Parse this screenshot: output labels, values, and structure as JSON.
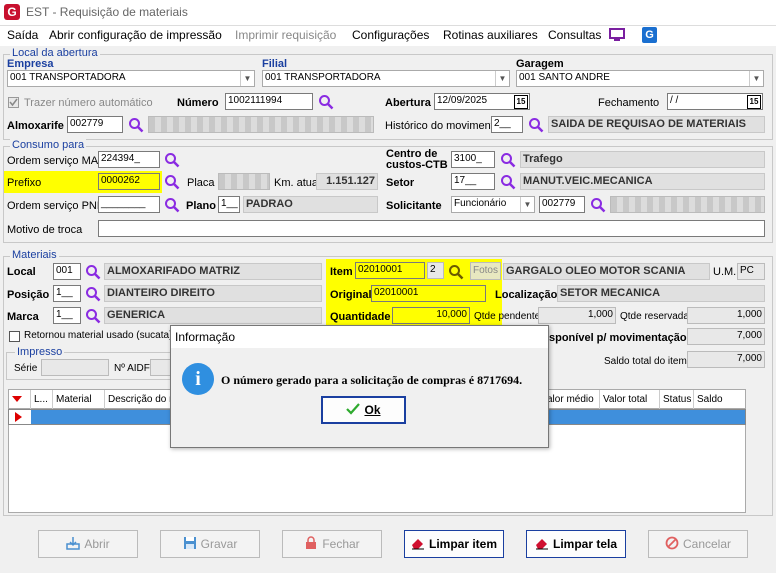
{
  "window": {
    "title": "EST - Requisição de materiais",
    "logo": "G"
  },
  "menu": [
    "Saída",
    "Abrir configuração de impressão",
    "Imprimir requisição",
    "Configurações",
    "Rotinas auxiliares",
    "Consultas"
  ],
  "local_abertura": {
    "title": "Local da abertura",
    "empresa_label": "Empresa",
    "empresa_value": "001 TRANSPORTADORA",
    "filial_label": "Filial",
    "filial_value": "001 TRANSPORTADORA",
    "garagem_label": "Garagem",
    "garagem_value": "001 SANTO ANDRE",
    "trazer_label": "Trazer número automático",
    "numero_label": "Número",
    "numero_value": "1002111994",
    "abertura_label": "Abertura",
    "abertura_value": "12/09/2025",
    "fechamento_label": "Fechamento",
    "fechamento_value": "/ /",
    "almoxarife_label": "Almoxarife",
    "almoxarife_value": "002779",
    "historico_label": "Histórico do movimento",
    "historico_code": "2__",
    "historico_value": "SAIDA DE REQUISAO DE MATERIAIS",
    "cal_glyph": "15"
  },
  "consumo": {
    "title": "Consumo para",
    "os_man_label": "Ordem serviço MAN",
    "os_man_value": "224394_",
    "centro_label_1": "Centro de",
    "centro_label_2": "custos-CTB",
    "centro_code": "3100_",
    "centro_value": "Trafego",
    "prefixo_label": "Prefixo",
    "prefixo_value": "0000262",
    "placa_label": "Placa",
    "km_label": "Km. atual",
    "km_value": "1.151.127",
    "setor_label": "Setor",
    "setor_code": "17__",
    "setor_value": "MANUT.VEIC.MECANICA",
    "os_pne_label": "Ordem serviço PNE",
    "os_pne_value": "________",
    "plano_label": "Plano",
    "plano_code": "1__",
    "plano_value": "PADRAO",
    "solicitante_label": "Solicitante",
    "solicitante_type": "Funcionário",
    "solicitante_code": "002779",
    "motivo_label": "Motivo de troca"
  },
  "materiais": {
    "title": "Materiais",
    "local_label": "Local",
    "local_code": "001",
    "local_value": "ALMOXARIFADO MATRIZ",
    "item_label": "Item",
    "item_code": "02010001",
    "item_seq": "2",
    "fotos_label": "Fotos",
    "item_desc": "GARGALO OLEO MOTOR SCANIA",
    "um_label": "U.M.",
    "um_value": "PC",
    "posicao_label": "Posição",
    "posicao_code": "1__",
    "posicao_value": "DIANTEIRO DIREITO",
    "original_label": "Original",
    "original_value": "02010001",
    "localizacao_label": "Localização",
    "localizacao_value": "SETOR MECANICA",
    "marca_label": "Marca",
    "marca_code": "1__",
    "marca_value": "GENERICA",
    "quantidade_label": "Quantidade",
    "quantidade_value": "10,000",
    "qtde_pendente_label": "Qtde pendente",
    "qtde_pendente_value": "1,000",
    "qtde_reservada_label": "Qtde reservada",
    "qtde_reservada_value": "1,000",
    "retornou_label": "Retornou material usado (sucata)",
    "disponivel_label": "sponível p/ movimentação",
    "disponivel_value": "7,000",
    "impresso_title": "Impresso",
    "serie_label": "Série",
    "aidf_label": "Nº AIDF",
    "saldo_label": "Saldo total do item",
    "saldo_value": "7,000"
  },
  "table": {
    "columns": [
      "L...",
      "Material",
      "Descrição do m",
      "alor médio",
      "Valor total",
      "Status",
      "Saldo"
    ]
  },
  "dialog": {
    "title": "Informação",
    "message": "O número gerado para a solicitação de compras é 8717694.",
    "ok_label": "Ok",
    "info_glyph": "i"
  },
  "buttons": {
    "abrir": "Abrir",
    "gravar": "Gravar",
    "fechar": "Fechar",
    "limpar_item": "Limpar item",
    "limpar_tela": "Limpar tela",
    "cancelar": "Cancelar"
  }
}
